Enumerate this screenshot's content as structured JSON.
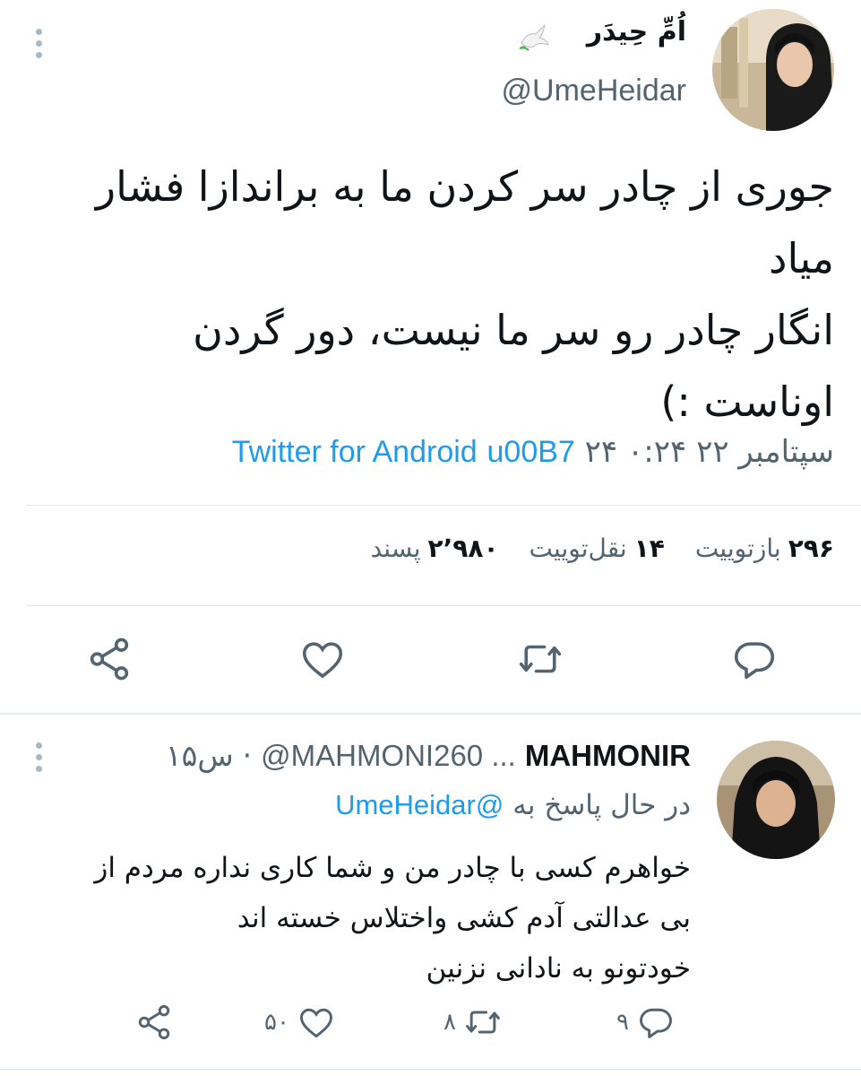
{
  "tweet": {
    "display_name": "اُمِّ حِیدَر",
    "handle": "@UmeHeidar",
    "text_lines": [
      "جوری از چادر سر کردن ما به براندازا فشار",
      "میاد",
      "انگار چادر رو سر ما نیست، دور گردن",
      "اوناست :)"
    ],
    "time": "۰:۲۴",
    "date": "۲۴ سپتامبر ۲۲",
    "garbled": "u00B7",
    "source": "Twitter for Android",
    "stats": {
      "retweets_count": "۲۹۶",
      "retweets_label": "بازتوییت",
      "quotes_count": "۱۴",
      "quotes_label": "نقل‌توییت",
      "likes_count": "۲٬۹۸۰",
      "likes_label": "پسند"
    },
    "actions": [
      "reply-icon",
      "retweet-icon",
      "like-icon",
      "share-icon"
    ]
  },
  "reply": {
    "display_name": "MAHMONIR",
    "handle": "@MAHMONI260 ...",
    "time": "۱۵س",
    "replying_prefix": "در حال پاسخ به",
    "replying_to": "@UmeHeidar",
    "text_lines": [
      "خواهرم کسی با چادر من و شما کاری نداره مردم از",
      "بی عدالتی آدم کشی واختلاس خسته اند",
      "خودتونو به نادانی نزنین"
    ],
    "reply_count": "۹",
    "retweet_count": "۸",
    "like_count": "۵۰"
  },
  "colors": {
    "accent": "#1d9bf0",
    "muted": "#536471",
    "text": "#0f1419",
    "divider": "#e1e8ed"
  }
}
